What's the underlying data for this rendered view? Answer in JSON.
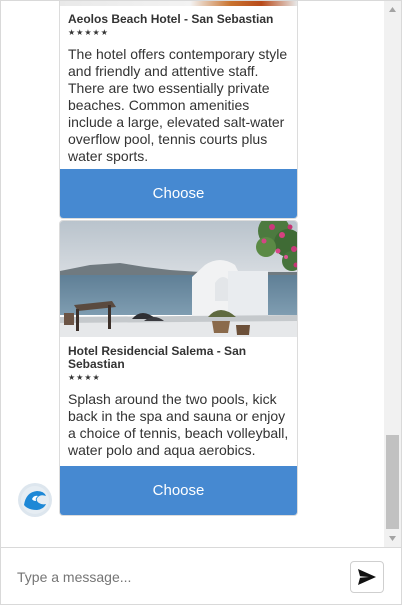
{
  "cards": [
    {
      "name": "Aeolos Beach Hotel - San Sebastian",
      "stars": "★★★★★",
      "description": "The hotel offers contemporary style and friendly and attentive staff. There are two essentially private beaches. Common amenities include a large, elevated salt-water overflow pool, tennis courts plus water sports.",
      "button_label": "Choose"
    },
    {
      "name": "Hotel Residencial Salema - San Sebastian",
      "stars": "★★★★",
      "description": "Splash around the two pools, kick back in the spa and sauna or enjoy a choice of tennis, beach volleyball, water polo and aqua aerobics.",
      "button_label": "Choose"
    }
  ],
  "composer": {
    "placeholder": "Type a message..."
  },
  "colors": {
    "accent": "#4689d1",
    "avatar_wave": "#1e88d6"
  },
  "icons": {
    "send": "send-icon",
    "avatar": "wave-icon"
  }
}
